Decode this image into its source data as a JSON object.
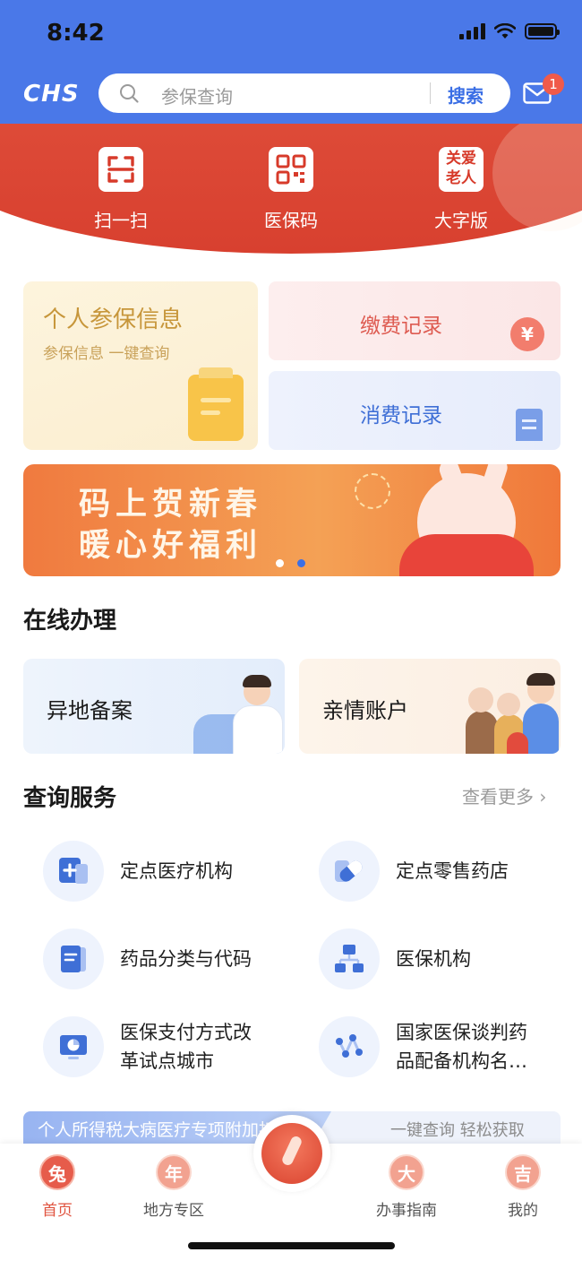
{
  "status_bar": {
    "time": "8:42"
  },
  "header": {
    "logo": "CHS",
    "search_placeholder": "参保查询",
    "search_button": "搜索",
    "mail_badge": "1"
  },
  "quick_actions": [
    {
      "label": "扫一扫",
      "icon": "scan-icon"
    },
    {
      "label": "医保码",
      "icon": "qr-code-icon"
    },
    {
      "label": "大字版",
      "icon": "care-elderly-icon",
      "icon_text_1": "关爱",
      "icon_text_2": "老人"
    }
  ],
  "cards": {
    "personal": {
      "title": "个人参保信息",
      "subtitle": "参保信息 一键查询"
    },
    "payment": {
      "title": "缴费记录",
      "icon_symbol": "¥"
    },
    "consumption": {
      "title": "消费记录"
    }
  },
  "banner": {
    "line1": "码上贺新春",
    "line2": "暖心好福利",
    "slides": 2,
    "active_slide": 2
  },
  "online": {
    "title": "在线办理",
    "items": [
      {
        "label": "异地备案"
      },
      {
        "label": "亲情账户"
      }
    ]
  },
  "query": {
    "title": "查询服务",
    "more": "查看更多 ›",
    "items": [
      {
        "label": "定点医疗机构",
        "icon": "medical-institution-icon"
      },
      {
        "label": "定点零售药店",
        "icon": "pill-icon"
      },
      {
        "label": "药品分类与代码",
        "icon": "drug-catalog-icon"
      },
      {
        "label": "医保机构",
        "icon": "org-structure-icon"
      },
      {
        "line1": "医保支付方式改",
        "line2": "革试点城市",
        "icon": "pie-chart-monitor-icon"
      },
      {
        "line1": "国家医保谈判药",
        "line2": "品配备机构名…",
        "icon": "network-icon"
      }
    ]
  },
  "notice": {
    "left": "个人所得税大病医疗专项附加扣除",
    "right": "一键查询 轻松获取"
  },
  "tabbar": {
    "items": [
      {
        "label": "首页",
        "glyph": "兔",
        "active": true
      },
      {
        "label": "地方专区",
        "glyph": "年",
        "active": false
      },
      {
        "label": "办事指南",
        "glyph": "大",
        "active": false
      },
      {
        "label": "我的",
        "glyph": "吉",
        "active": false
      }
    ]
  },
  "colors": {
    "header_blue": "#4a78e8",
    "accent_red": "#e0533f",
    "link_blue": "#3b6fe5"
  }
}
